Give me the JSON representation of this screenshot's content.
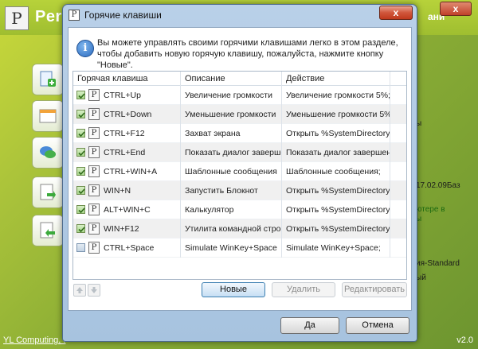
{
  "background_app": {
    "logo_glyph": "P",
    "title": "Per",
    "title_right": "ани",
    "close_glyph": "x",
    "right_texts": [
      "ы",
      "17.02.09Баз",
      "ютере в",
      "ы",
      "ия-Standard",
      "ый"
    ],
    "footer_link": "YL Computing, I",
    "version": "v2.0"
  },
  "dialog": {
    "icon_glyph": "P",
    "title": "Горячие клавиши",
    "close_glyph": "x",
    "info_glyph": "i",
    "info_text": "Вы можете управлять своими горячими клавишами легко в этом разделе, чтобы добавить новую горячую клавишу, пожалуйста, нажмите кнопку \"Новые\".",
    "columns": [
      "Горячая клавиша",
      "Описание",
      "Действие"
    ],
    "rows": [
      {
        "checked": true,
        "icon": "P",
        "hotkey": "CTRL+Up",
        "description": "Увеличение громкости",
        "action": "Увеличение громкости 5%;"
      },
      {
        "checked": true,
        "icon": "P",
        "hotkey": "CTRL+Down",
        "description": "Уменьшение громкости",
        "action": "Уменьшение громкости 5%;"
      },
      {
        "checked": true,
        "icon": "P",
        "hotkey": "CTRL+F12",
        "description": "Захват экрана",
        "action": "Открыть %SystemDirectory%"
      },
      {
        "checked": true,
        "icon": "P",
        "hotkey": "CTRL+End",
        "description": "Показать диалог завершен",
        "action": "Показать диалог завершения"
      },
      {
        "checked": true,
        "icon": "P",
        "hotkey": "CTRL+WIN+A",
        "description": "Шаблонные сообщения",
        "action": "Шаблонные сообщения;"
      },
      {
        "checked": true,
        "icon": "P",
        "hotkey": "WIN+N",
        "description": "Запустить Блокнот",
        "action": "Открыть %SystemDirectory%"
      },
      {
        "checked": true,
        "icon": "P",
        "hotkey": "ALT+WIN+C",
        "description": "Калькулятор",
        "action": "Открыть %SystemDirectory%"
      },
      {
        "checked": true,
        "icon": "P",
        "hotkey": "WIN+F12",
        "description": "Утилита командной строки",
        "action": "Открыть %SystemDirectory%"
      },
      {
        "checked": false,
        "icon": "P",
        "hotkey": "CTRL+Space",
        "description": "Simulate WinKey+Space",
        "action": "Simulate WinKey+Space;"
      }
    ],
    "buttons": {
      "new": "Новые",
      "delete": "Удалить",
      "edit": "Редактировать",
      "ok": "Да",
      "cancel": "Отмена"
    }
  },
  "colors": {
    "accent_border": "#3c7fb1",
    "dialog_frame": "#a7c3df",
    "background_green": "#8cae35"
  }
}
